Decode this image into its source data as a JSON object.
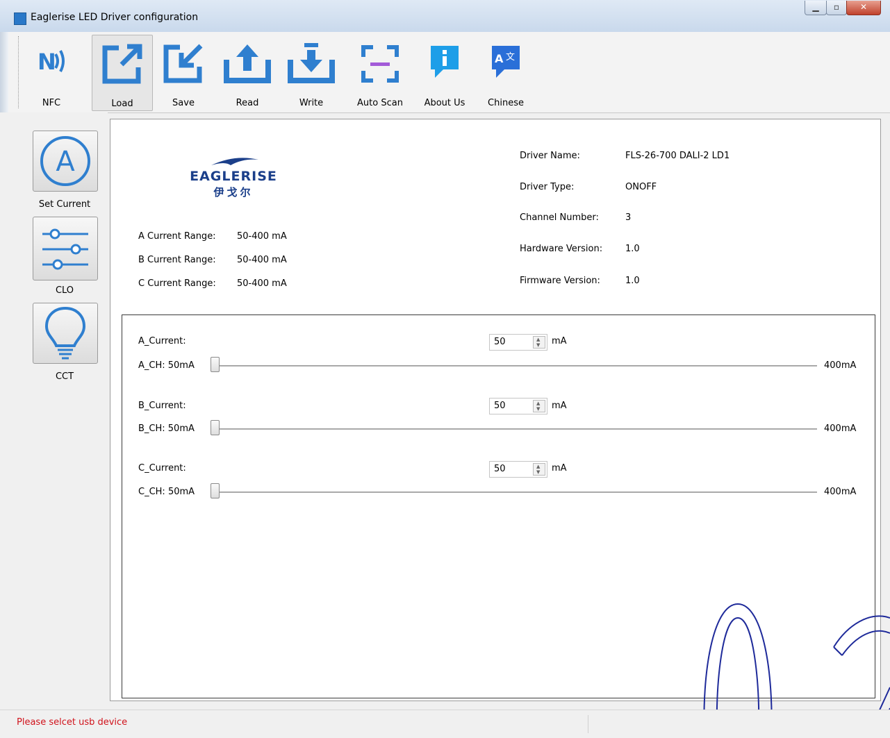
{
  "window": {
    "title": "Eaglerise LED Driver configuration"
  },
  "toolbar": {
    "nfc": "NFC",
    "load": "Load",
    "save": "Save",
    "read": "Read",
    "write": "Write",
    "auto_scan": "Auto Scan",
    "about_us": "About Us",
    "chinese": "Chinese"
  },
  "sidebar": {
    "set_current": "Set Current",
    "clo": "CLO",
    "cct": "CCT"
  },
  "logo": {
    "brand": "EAGLERISE",
    "brand_cn": "伊戈尔"
  },
  "info": {
    "driver_name_label": "Driver Name:",
    "driver_name": "FLS-26-700 DALI-2 LD1",
    "driver_type_label": "Driver Type:",
    "driver_type": "ONOFF",
    "channel_number_label": "Channel Number:",
    "channel_number": "3",
    "hardware_version_label": "Hardware Version:",
    "hardware_version": "1.0",
    "firmware_version_label": "Firmware Version:",
    "firmware_version": "1.0"
  },
  "ranges": {
    "a_label": "A Current Range:",
    "a_value": "50-400 mA",
    "b_label": "B Current Range:",
    "b_value": "50-400 mA",
    "c_label": "C Current Range:",
    "c_value": "50-400 mA"
  },
  "channels": [
    {
      "current_label": "A_Current:",
      "value": "50",
      "unit": "mA",
      "slider_label": "A_CH: 50mA",
      "max_label": "400mA",
      "min": 50,
      "max": 400,
      "current": 50
    },
    {
      "current_label": "B_Current:",
      "value": "50",
      "unit": "mA",
      "slider_label": "B_CH: 50mA",
      "max_label": "400mA",
      "min": 50,
      "max": 400,
      "current": 50
    },
    {
      "current_label": "C_Current:",
      "value": "50",
      "unit": "mA",
      "slider_label": "C_CH: 50mA",
      "max_label": "400mA",
      "min": 50,
      "max": 400,
      "current": 50
    }
  ],
  "status": {
    "message": "Please selcet usb device"
  },
  "colors": {
    "accent": "#2f7fcf",
    "scan_bar": "#a35bd8",
    "status_text": "#d0121b"
  }
}
